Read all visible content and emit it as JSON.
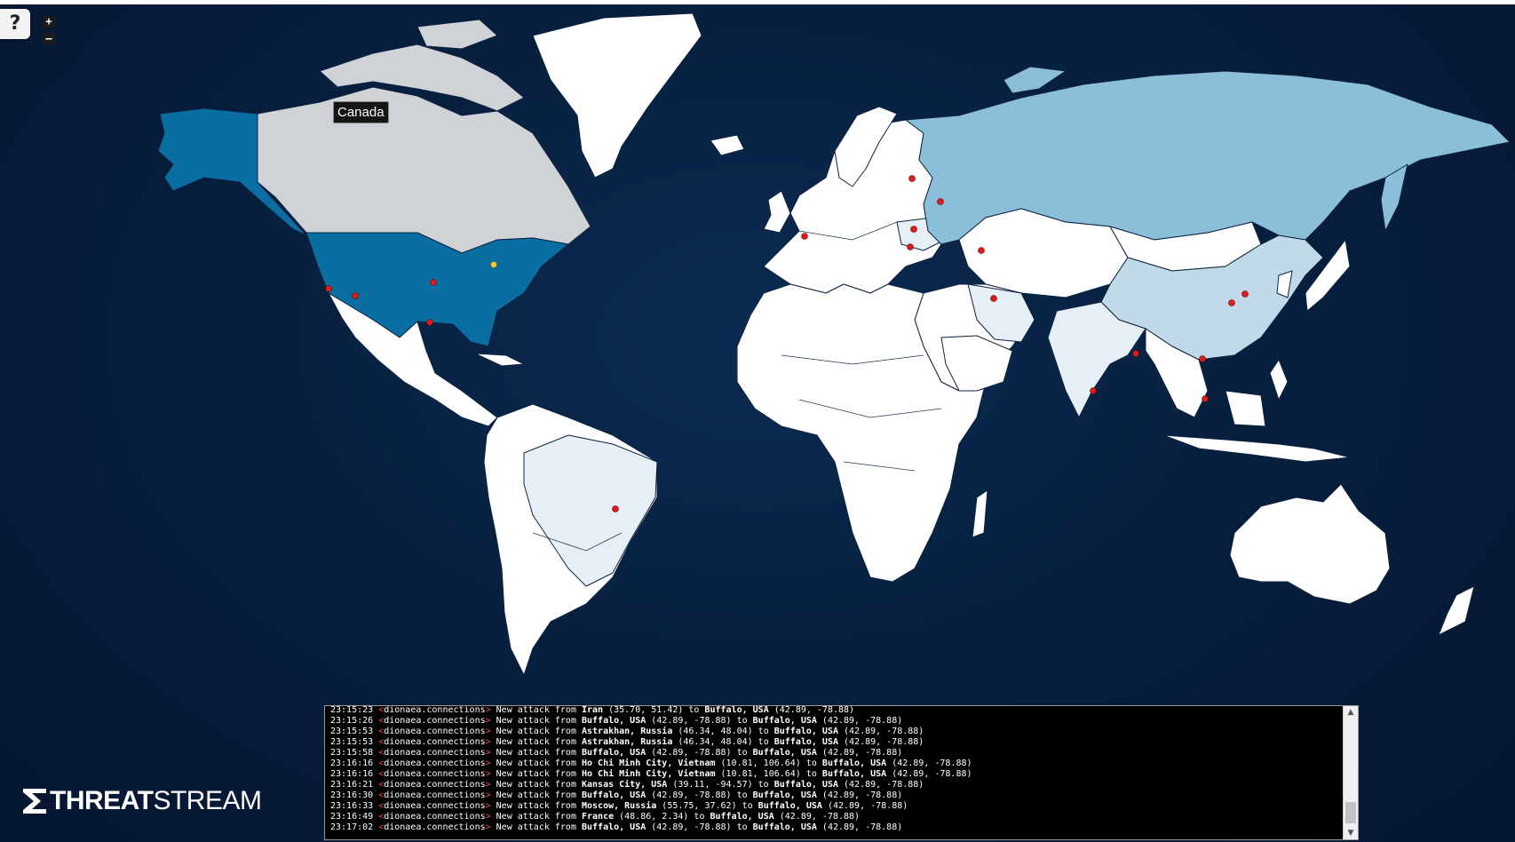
{
  "window": {
    "title": "THREATSTREAM"
  },
  "help": {
    "label": "?"
  },
  "zoom": {
    "in_label": "+",
    "out_label": "–"
  },
  "tooltip": {
    "text": "Canada"
  },
  "brand": {
    "word1": "THREAT",
    "word2": "STREAM"
  },
  "colors": {
    "ocean": "#07203f",
    "highlight_usa": "#0b6ea3",
    "russia": "#8bbfd9",
    "china": "#c0dae9",
    "canada": "#cfd2d6",
    "light": "#e6eff6",
    "land": "#ffffff",
    "marker": "#e01b1b",
    "target": "#f0d040"
  },
  "log": {
    "entries": [
      {
        "time": "23:15:23",
        "source": "dionaea.connections",
        "text": "New attack from ",
        "from": "Iran",
        "from_coords": "(35.70, 51.42)",
        "to": "Buffalo, USA",
        "to_coords": "(42.89, -78.88)"
      },
      {
        "time": "23:15:26",
        "source": "dionaea.connections",
        "text": "New attack from ",
        "from": "Buffalo, USA",
        "from_coords": "(42.89, -78.88)",
        "to": "Buffalo, USA",
        "to_coords": "(42.89, -78.88)"
      },
      {
        "time": "23:15:53",
        "source": "dionaea.connections",
        "text": "New attack from ",
        "from": "Astrakhan, Russia",
        "from_coords": "(46.34, 48.04)",
        "to": "Buffalo, USA",
        "to_coords": "(42.89, -78.88)"
      },
      {
        "time": "23:15:53",
        "source": "dionaea.connections",
        "text": "New attack from ",
        "from": "Astrakhan, Russia",
        "from_coords": "(46.34, 48.04)",
        "to": "Buffalo, USA",
        "to_coords": "(42.89, -78.88)"
      },
      {
        "time": "23:15:58",
        "source": "dionaea.connections",
        "text": "New attack from ",
        "from": "Buffalo, USA",
        "from_coords": "(42.89, -78.88)",
        "to": "Buffalo, USA",
        "to_coords": "(42.89, -78.88)"
      },
      {
        "time": "23:16:16",
        "source": "dionaea.connections",
        "text": "New attack from ",
        "from": "Ho Chi Minh City, Vietnam",
        "from_coords": "(10.81, 106.64)",
        "to": "Buffalo, USA",
        "to_coords": "(42.89, -78.88)"
      },
      {
        "time": "23:16:16",
        "source": "dionaea.connections",
        "text": "New attack from ",
        "from": "Ho Chi Minh City, Vietnam",
        "from_coords": "(10.81, 106.64)",
        "to": "Buffalo, USA",
        "to_coords": "(42.89, -78.88)"
      },
      {
        "time": "23:16:21",
        "source": "dionaea.connections",
        "text": "New attack from ",
        "from": "Kansas City, USA",
        "from_coords": "(39.11, -94.57)",
        "to": "Buffalo, USA",
        "to_coords": "(42.89, -78.88)"
      },
      {
        "time": "23:16:30",
        "source": "dionaea.connections",
        "text": "New attack from ",
        "from": "Buffalo, USA",
        "from_coords": "(42.89, -78.88)",
        "to": "Buffalo, USA",
        "to_coords": "(42.89, -78.88)"
      },
      {
        "time": "23:16:33",
        "source": "dionaea.connections",
        "text": "New attack from ",
        "from": "Moscow, Russia",
        "from_coords": "(55.75, 37.62)",
        "to": "Buffalo, USA",
        "to_coords": "(42.89, -78.88)"
      },
      {
        "time": "23:16:49",
        "source": "dionaea.connections",
        "text": "New attack from ",
        "from": "France",
        "from_coords": "(48.86, 2.34)",
        "to": "Buffalo, USA",
        "to_coords": "(42.89, -78.88)"
      },
      {
        "time": "23:17:02",
        "source": "dionaea.connections",
        "text": "New attack from ",
        "from": "Buffalo, USA",
        "from_coords": "(42.89, -78.88)",
        "to": "Buffalo, USA",
        "to_coords": "(42.89, -78.88)"
      }
    ]
  }
}
